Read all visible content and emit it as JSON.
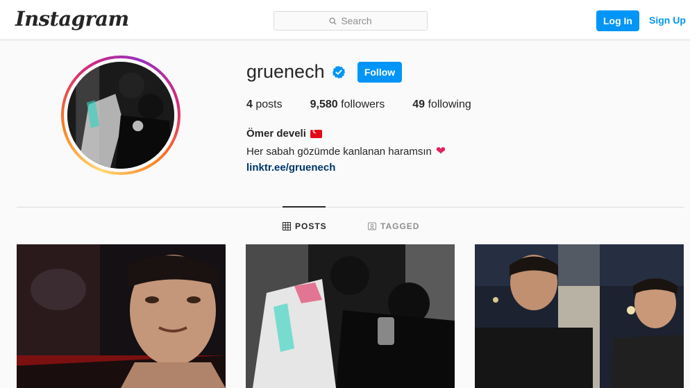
{
  "nav": {
    "logo": "Instagram",
    "search_placeholder": "Search",
    "login_label": "Log In",
    "signup_label": "Sign Up"
  },
  "profile": {
    "username": "gruenech",
    "follow_label": "Follow",
    "stats": {
      "posts_count": "4",
      "posts_label": "posts",
      "followers_count": "9,580",
      "followers_label": "followers",
      "following_count": "49",
      "following_label": "following"
    },
    "full_name": "Ömer develi",
    "bio": "Her sabah gözümde kanlanan haramsın",
    "link": "linktr.ee/gruenech"
  },
  "tabs": [
    {
      "label": "POSTS",
      "active": true,
      "icon": "grid-icon"
    },
    {
      "label": "TAGGED",
      "active": false,
      "icon": "tagged-icon"
    }
  ],
  "colors": {
    "accent": "#0095f6",
    "link": "#00376b",
    "text": "#262626",
    "muted": "#8e8e8e"
  }
}
